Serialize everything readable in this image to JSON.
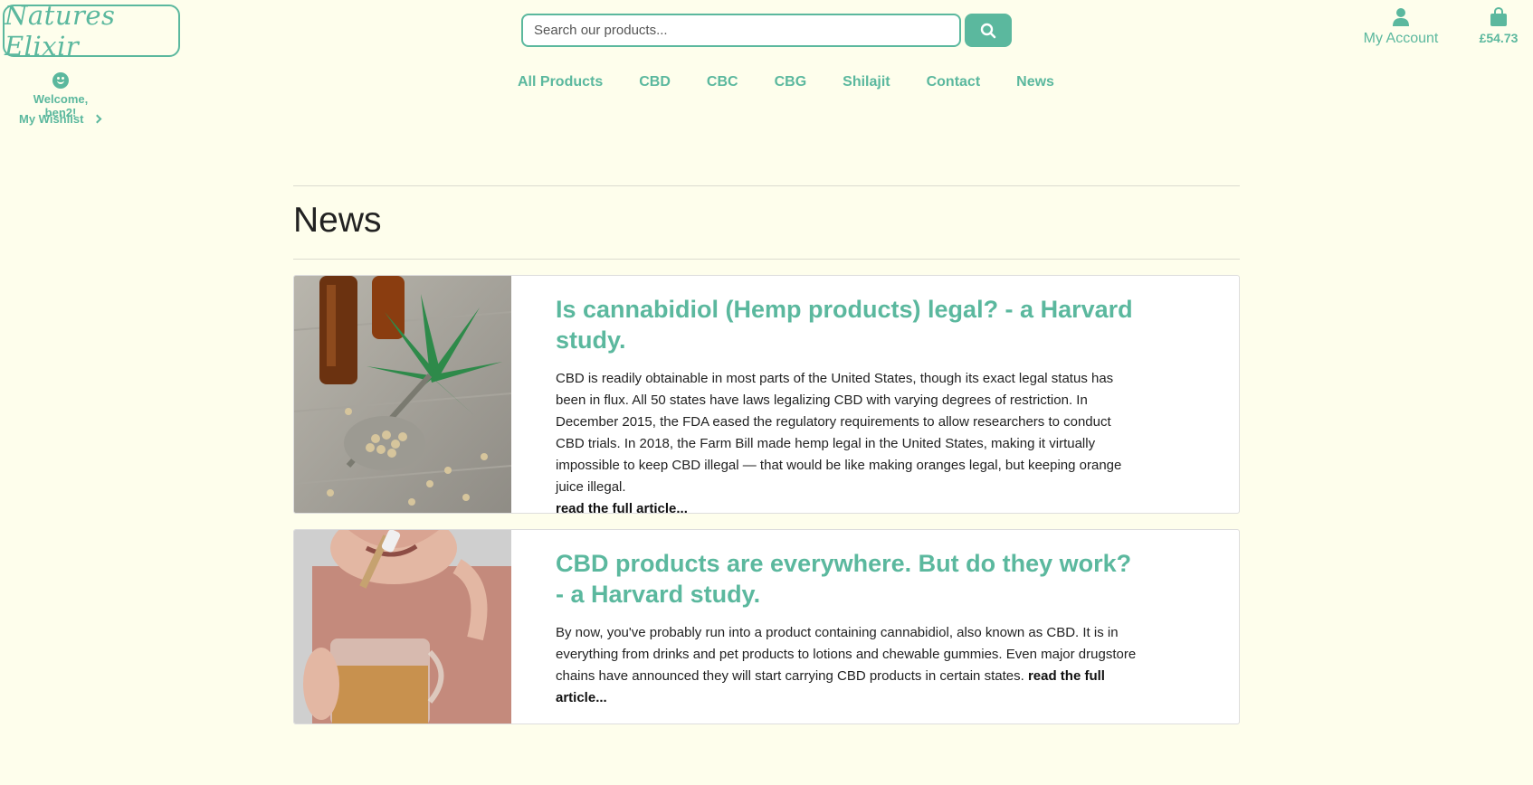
{
  "header": {
    "logo_text": "Natures Elixir",
    "welcome": "Welcome, ben2!",
    "wishlist": "My Wishlist",
    "search_placeholder": "Search our products...",
    "account_label": "My Account",
    "cart_total": "£54.73"
  },
  "nav": {
    "items": [
      {
        "label": "All Products"
      },
      {
        "label": "CBD"
      },
      {
        "label": "CBC"
      },
      {
        "label": "CBG"
      },
      {
        "label": "Shilajit"
      },
      {
        "label": "Contact"
      },
      {
        "label": "News"
      }
    ]
  },
  "main": {
    "title": "News",
    "articles": [
      {
        "title": "Is cannabidiol (Hemp products) legal? - a Harvard study.",
        "body": "CBD is readily obtainable in most parts of the United States, though its exact legal status has been in flux. All 50 states have laws legalizing CBD with varying degrees of restriction. In December 2015, the FDA eased the regulatory requirements to allow researchers to conduct CBD trials. In 2018, the Farm Bill made hemp legal in the United States, making it virtually impossible to keep CBD illegal — that would be like making oranges legal, but keeping orange juice illegal.",
        "read_more": "read the full article..."
      },
      {
        "title": "CBD products are everywhere. But do they work? - a Harvard study.",
        "body": "By now, you've probably run into a product containing cannabidiol, also known as CBD. It is in everything from drinks and pet products to lotions and chewable gummies. Even major drugstore chains have announced they will start carrying CBD products in certain states.",
        "read_more": "read the full article..."
      }
    ]
  },
  "colors": {
    "accent": "#5bb89e",
    "background": "#fefeec"
  }
}
